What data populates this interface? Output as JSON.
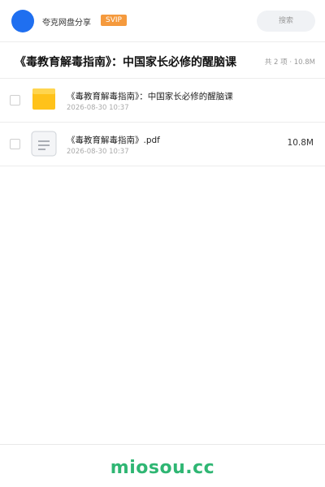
{
  "header": {
    "brand": "夸克网盘分享",
    "badge": "SVIP",
    "search_placeholder": "搜索"
  },
  "folder": {
    "title": "《毒教育解毒指南》：中国家长必修的醒脑课",
    "summary": "共 2 项 · 10.8M"
  },
  "files": [
    {
      "icon": "folder-icon",
      "name": "《毒教育解毒指南》：中国家长必修的醒脑课",
      "date": "2026-08-30 10:37",
      "size": ""
    },
    {
      "icon": "document-icon",
      "name": "《毒教育解毒指南》.pdf",
      "date": "2026-08-30 10:37",
      "size": "10.8M"
    }
  ],
  "footer": {
    "watermark": "miosou.cc"
  },
  "colors": {
    "accent": "#1f6ff0",
    "svip": "#f59a3d",
    "folder": "#ffc21a",
    "watermark": "#2fb673"
  }
}
